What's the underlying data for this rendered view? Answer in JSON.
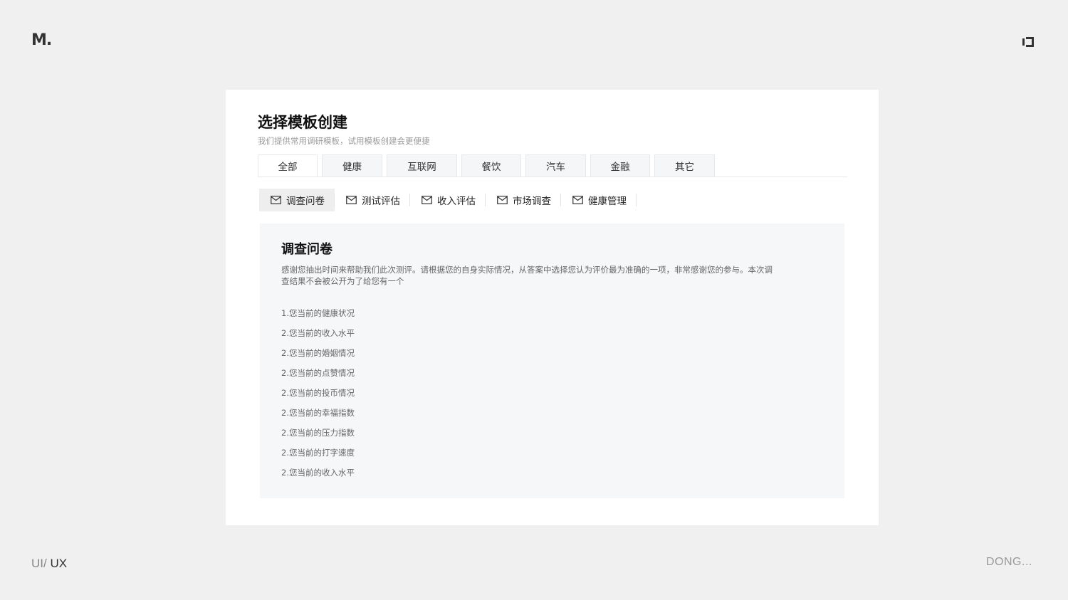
{
  "brand": {
    "logo_text": "M."
  },
  "corner_icon": "window-toggle-icon",
  "footer": {
    "left_light": "UI/",
    "left_strong": "UX",
    "right": "DONG..."
  },
  "dialog": {
    "title": "选择模板创建",
    "subtitle": "我们提供常用调研模板，试用模板创建会更便捷"
  },
  "category_tabs": [
    {
      "label": "全部"
    },
    {
      "label": "健康"
    },
    {
      "label": "互联网"
    },
    {
      "label": "餐饮"
    },
    {
      "label": "汽车"
    },
    {
      "label": "金融"
    },
    {
      "label": "其它"
    }
  ],
  "template_tabs": [
    {
      "label": "调查问卷",
      "icon": "mail-icon"
    },
    {
      "label": "测试评估",
      "icon": "mail-icon"
    },
    {
      "label": "收入评估",
      "icon": "mail-icon"
    },
    {
      "label": "市场调查",
      "icon": "mail-icon"
    },
    {
      "label": "健康管理",
      "icon": "mail-icon"
    }
  ],
  "preview": {
    "title": "调查问卷",
    "description": "感谢您抽出时间来帮助我们此次测评。请根据您的自身实际情况，从答案中选择您认为评价最为准确的一项，非常感谢您的参与。本次调查结果不会被公开为了给您有一个",
    "questions": [
      "1.您当前的健康状况",
      "2.您当前的收入水平",
      "2.您当前的婚姻情况",
      "2.您当前的点赞情况",
      "2.您当前的投币情况",
      "2.您当前的幸福指数",
      "2.您当前的压力指数",
      "2.您当前的打字速度",
      "2.您当前的收入水平"
    ]
  }
}
